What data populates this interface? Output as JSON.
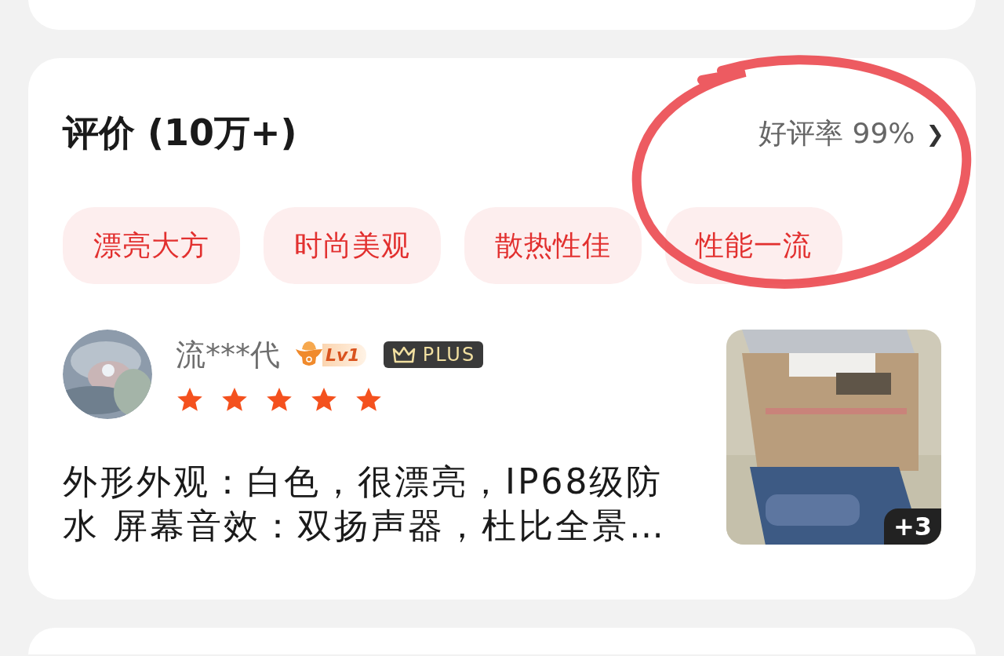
{
  "header": {
    "title": "评价 (10万+)",
    "rating_label": "好评率 99%",
    "chevron": "❯"
  },
  "tags": [
    {
      "label": "漂亮大方"
    },
    {
      "label": "时尚美观"
    },
    {
      "label": "散热性佳"
    },
    {
      "label": "性能一流"
    }
  ],
  "review": {
    "user": "流***代",
    "level_badge": "Lv1",
    "member_badge": "PLUS",
    "stars": 5,
    "text": "外形外观：白色，很漂亮，IP68级防水 屏幕音效：双扬声器，杜比全景…",
    "photo": {
      "kind": "picture",
      "more_count": "+3"
    }
  },
  "annotation": {
    "kind": "circle"
  }
}
